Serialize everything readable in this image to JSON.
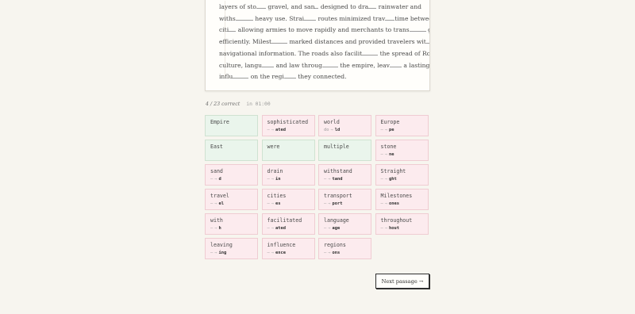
{
  "passage": {
    "lines": [
      [
        {
          "t": "layers of sto"
        },
        {
          "b": 12
        },
        {
          "t": " gravel, and san"
        },
        {
          "b": 5
        },
        {
          "t": " designed to dra"
        },
        {
          "b": 10
        },
        {
          "t": " rainwater and"
        }
      ],
      [
        {
          "t": "withs"
        },
        {
          "b": 22
        },
        {
          "t": " heavy use. Strai"
        },
        {
          "b": 15
        },
        {
          "t": " routes minimized trav"
        },
        {
          "b": 12
        },
        {
          "t": "time between"
        }
      ],
      [
        {
          "t": "citi"
        },
        {
          "b": 9
        },
        {
          "t": " allowing armies to move rapidly and merchants to trans"
        },
        {
          "b": 21
        },
        {
          "t": " goods"
        }
      ],
      [
        {
          "t": "efficiently. Milest"
        },
        {
          "b": 20
        },
        {
          "t": " marked distances and provided travelers wit"
        },
        {
          "b": 4
        }
      ],
      [
        {
          "t": "navigational information. The roads also facilit"
        },
        {
          "b": 20
        },
        {
          "t": " the spread of Roman"
        }
      ],
      [
        {
          "t": "culture, langu"
        },
        {
          "b": 15
        },
        {
          "t": " and law throug"
        },
        {
          "b": 20
        },
        {
          "t": " the empire, leav"
        },
        {
          "b": 15
        },
        {
          "t": " a lasting"
        }
      ],
      [
        {
          "t": "influ"
        },
        {
          "b": 20
        },
        {
          "t": " on the regi"
        },
        {
          "b": 15
        },
        {
          "t": " they connected."
        }
      ]
    ]
  },
  "stats": {
    "score": "4 / 23 correct",
    "time": "in 01:00"
  },
  "tiles": [
    {
      "word": "Empire",
      "status": "correct"
    },
    {
      "word": "sophisticated",
      "status": "wrong",
      "dash": "—",
      "arrow": "→",
      "answer": "ated"
    },
    {
      "word": "world",
      "status": "wrong",
      "dash": "do",
      "arrow": "→",
      "answer": "ld"
    },
    {
      "word": "Europe",
      "status": "wrong",
      "dash": "—",
      "arrow": "→",
      "answer": "pe"
    },
    {
      "word": "East",
      "status": "correct"
    },
    {
      "word": "were",
      "status": "correct"
    },
    {
      "word": "multiple",
      "status": "correct"
    },
    {
      "word": "stone",
      "status": "wrong",
      "dash": "—",
      "arrow": "→",
      "answer": "ne"
    },
    {
      "word": "sand",
      "status": "wrong",
      "dash": "—",
      "arrow": "→",
      "answer": "d"
    },
    {
      "word": "drain",
      "status": "wrong",
      "dash": "—",
      "arrow": "→",
      "answer": "in"
    },
    {
      "word": "withstand",
      "status": "wrong",
      "dash": "—",
      "arrow": "→",
      "answer": "tand"
    },
    {
      "word": "Straight",
      "status": "wrong",
      "dash": "—",
      "arrow": "→",
      "answer": "ght"
    },
    {
      "word": "travel",
      "status": "wrong",
      "dash": "—",
      "arrow": "→",
      "answer": "el"
    },
    {
      "word": "cities",
      "status": "wrong",
      "dash": "—",
      "arrow": "→",
      "answer": "es"
    },
    {
      "word": "transport",
      "status": "wrong",
      "dash": "—",
      "arrow": "→",
      "answer": "port"
    },
    {
      "word": "Milestones",
      "status": "wrong",
      "dash": "—",
      "arrow": "→",
      "answer": "ones"
    },
    {
      "word": "with",
      "status": "wrong",
      "dash": "—",
      "arrow": "→",
      "answer": "h"
    },
    {
      "word": "facilitated",
      "status": "wrong",
      "dash": "—",
      "arrow": "→",
      "answer": "ated"
    },
    {
      "word": "language",
      "status": "wrong",
      "dash": "—",
      "arrow": "→",
      "answer": "age"
    },
    {
      "word": "throughout",
      "status": "wrong",
      "dash": "—",
      "arrow": "→",
      "answer": "hout"
    },
    {
      "word": "leaving",
      "status": "wrong",
      "dash": "—",
      "arrow": "→",
      "answer": "ing"
    },
    {
      "word": "influence",
      "status": "wrong",
      "dash": "—",
      "arrow": "→",
      "answer": "ence"
    },
    {
      "word": "regions",
      "status": "wrong",
      "dash": "—",
      "arrow": "→",
      "answer": "ons"
    }
  ],
  "next_label": "Next passage →",
  "colors": {
    "correct_bg": "#eaf5ec",
    "wrong_bg": "#fcebee",
    "page_bg": "#f7f5ef"
  }
}
